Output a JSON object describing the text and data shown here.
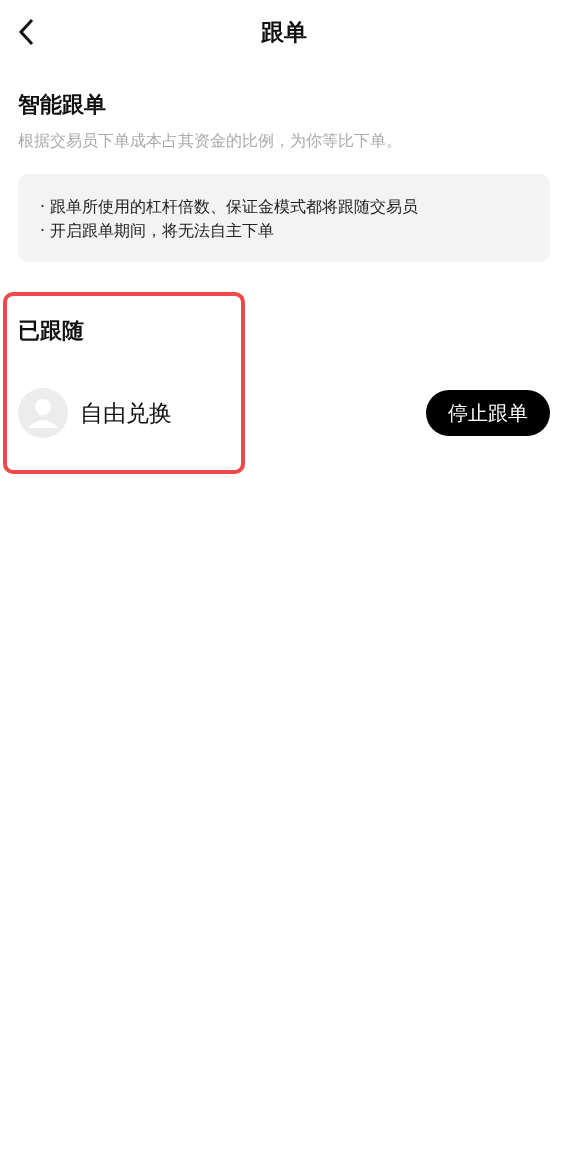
{
  "header": {
    "title": "跟单"
  },
  "intro": {
    "title": "智能跟单",
    "subtitle": "根据交易员下单成本占其资金的比例，为你等比下单。"
  },
  "notes": [
    "· 跟单所使用的杠杆倍数、保证金模式都将跟随交易员",
    "· 开启跟单期间，将无法自主下单"
  ],
  "following": {
    "title": "已跟随",
    "highlighted": true,
    "trader": {
      "name": "自由兑换"
    },
    "button": "停止跟单"
  }
}
